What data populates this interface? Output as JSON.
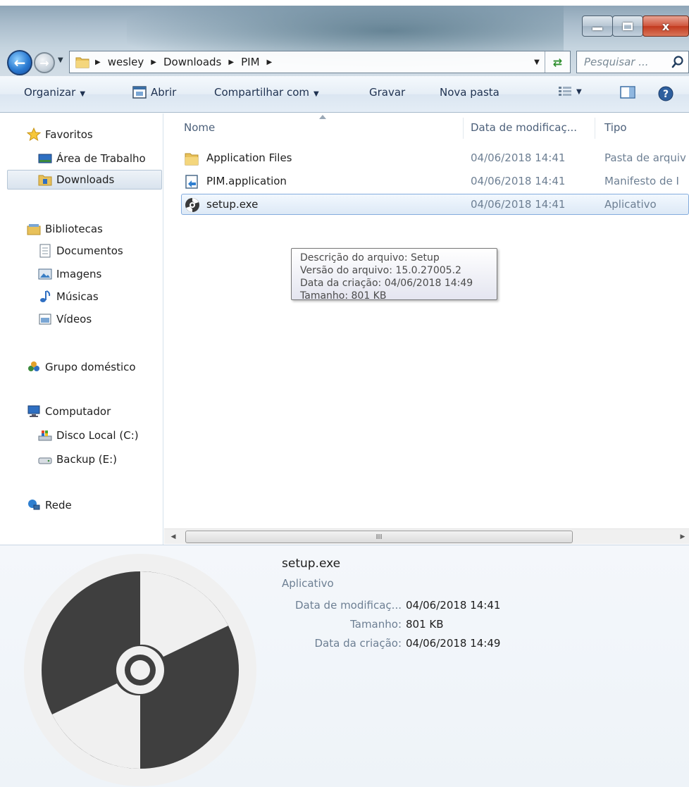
{
  "window": {
    "minimize_glyph": "",
    "close_glyph": "x"
  },
  "address": {
    "crumbs": [
      "wesley",
      "Downloads",
      "PIM"
    ],
    "search_placeholder": "Pesquisar ..."
  },
  "toolbar": {
    "organize": "Organizar",
    "open": "Abrir",
    "share": "Compartilhar com",
    "burn": "Gravar",
    "new_folder": "Nova pasta"
  },
  "sidebar": {
    "favorites": "Favoritos",
    "desktop": "Área de Trabalho",
    "downloads": "Downloads",
    "libraries": "Bibliotecas",
    "documents": "Documentos",
    "pictures": "Imagens",
    "music": "Músicas",
    "videos": "Vídeos",
    "homegroup": "Grupo doméstico",
    "computer": "Computador",
    "disk_c": "Disco Local (C:)",
    "backup_e": "Backup (E:)",
    "network": "Rede"
  },
  "columns": {
    "name": "Nome",
    "date": "Data de modificaç...",
    "type": "Tipo"
  },
  "files": [
    {
      "name": "Application Files",
      "date": "04/06/2018 14:41",
      "type": "Pasta de arquiv"
    },
    {
      "name": "PIM.application",
      "date": "04/06/2018 14:41",
      "type": "Manifesto de I"
    },
    {
      "name": "setup.exe",
      "date": "04/06/2018 14:41",
      "type": "Aplicativo"
    }
  ],
  "tooltip": {
    "line1": "Descrição do arquivo: Setup",
    "line2": "Versão do arquivo: 15.0.27005.2",
    "line3": "Data da criação: 04/06/2018 14:49",
    "line4": "Tamanho: 801 KB"
  },
  "scrollbar": {
    "grip": "III"
  },
  "details": {
    "name": "setup.exe",
    "type": "Aplicativo",
    "modified_label": "Data de modificaç...",
    "modified_value": "04/06/2018 14:41",
    "size_label": "Tamanho:",
    "size_value": "801 KB",
    "created_label": "Data da criação:",
    "created_value": "04/06/2018 14:49"
  },
  "colors": {
    "selection_border": "#84acdd",
    "link_text": "#1e3150"
  }
}
